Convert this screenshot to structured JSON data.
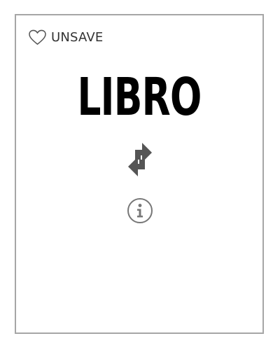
{
  "card": {
    "save_label": "UNSAVE",
    "word": "LIBRO",
    "icons": {
      "save": "heart-icon",
      "flip": "flip-arrows-icon",
      "info": "info-icon"
    }
  }
}
